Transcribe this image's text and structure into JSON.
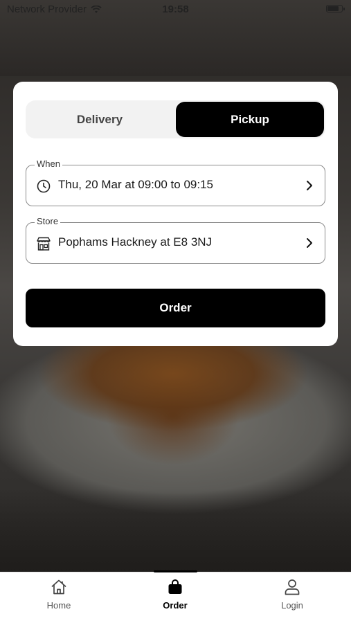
{
  "status_bar": {
    "carrier": "Network Provider",
    "time": "19:58"
  },
  "segment": {
    "delivery_label": "Delivery",
    "pickup_label": "Pickup",
    "selected": "Pickup"
  },
  "when_field": {
    "legend": "When",
    "value": "Thu, 20 Mar at 09:00 to 09:15",
    "icon": "clock-icon"
  },
  "store_field": {
    "legend": "Store",
    "value": "Pophams Hackney at E8 3NJ",
    "icon": "store-icon"
  },
  "order_button": {
    "label": "Order"
  },
  "tab_bar": {
    "tabs": [
      {
        "label": "Home",
        "icon": "home-icon"
      },
      {
        "label": "Order",
        "icon": "bag-icon",
        "active": true
      },
      {
        "label": "Login",
        "icon": "user-icon"
      }
    ]
  },
  "colors": {
    "primary": "#000000",
    "card_background": "#ffffff",
    "segment_background": "#f2f2f2"
  }
}
